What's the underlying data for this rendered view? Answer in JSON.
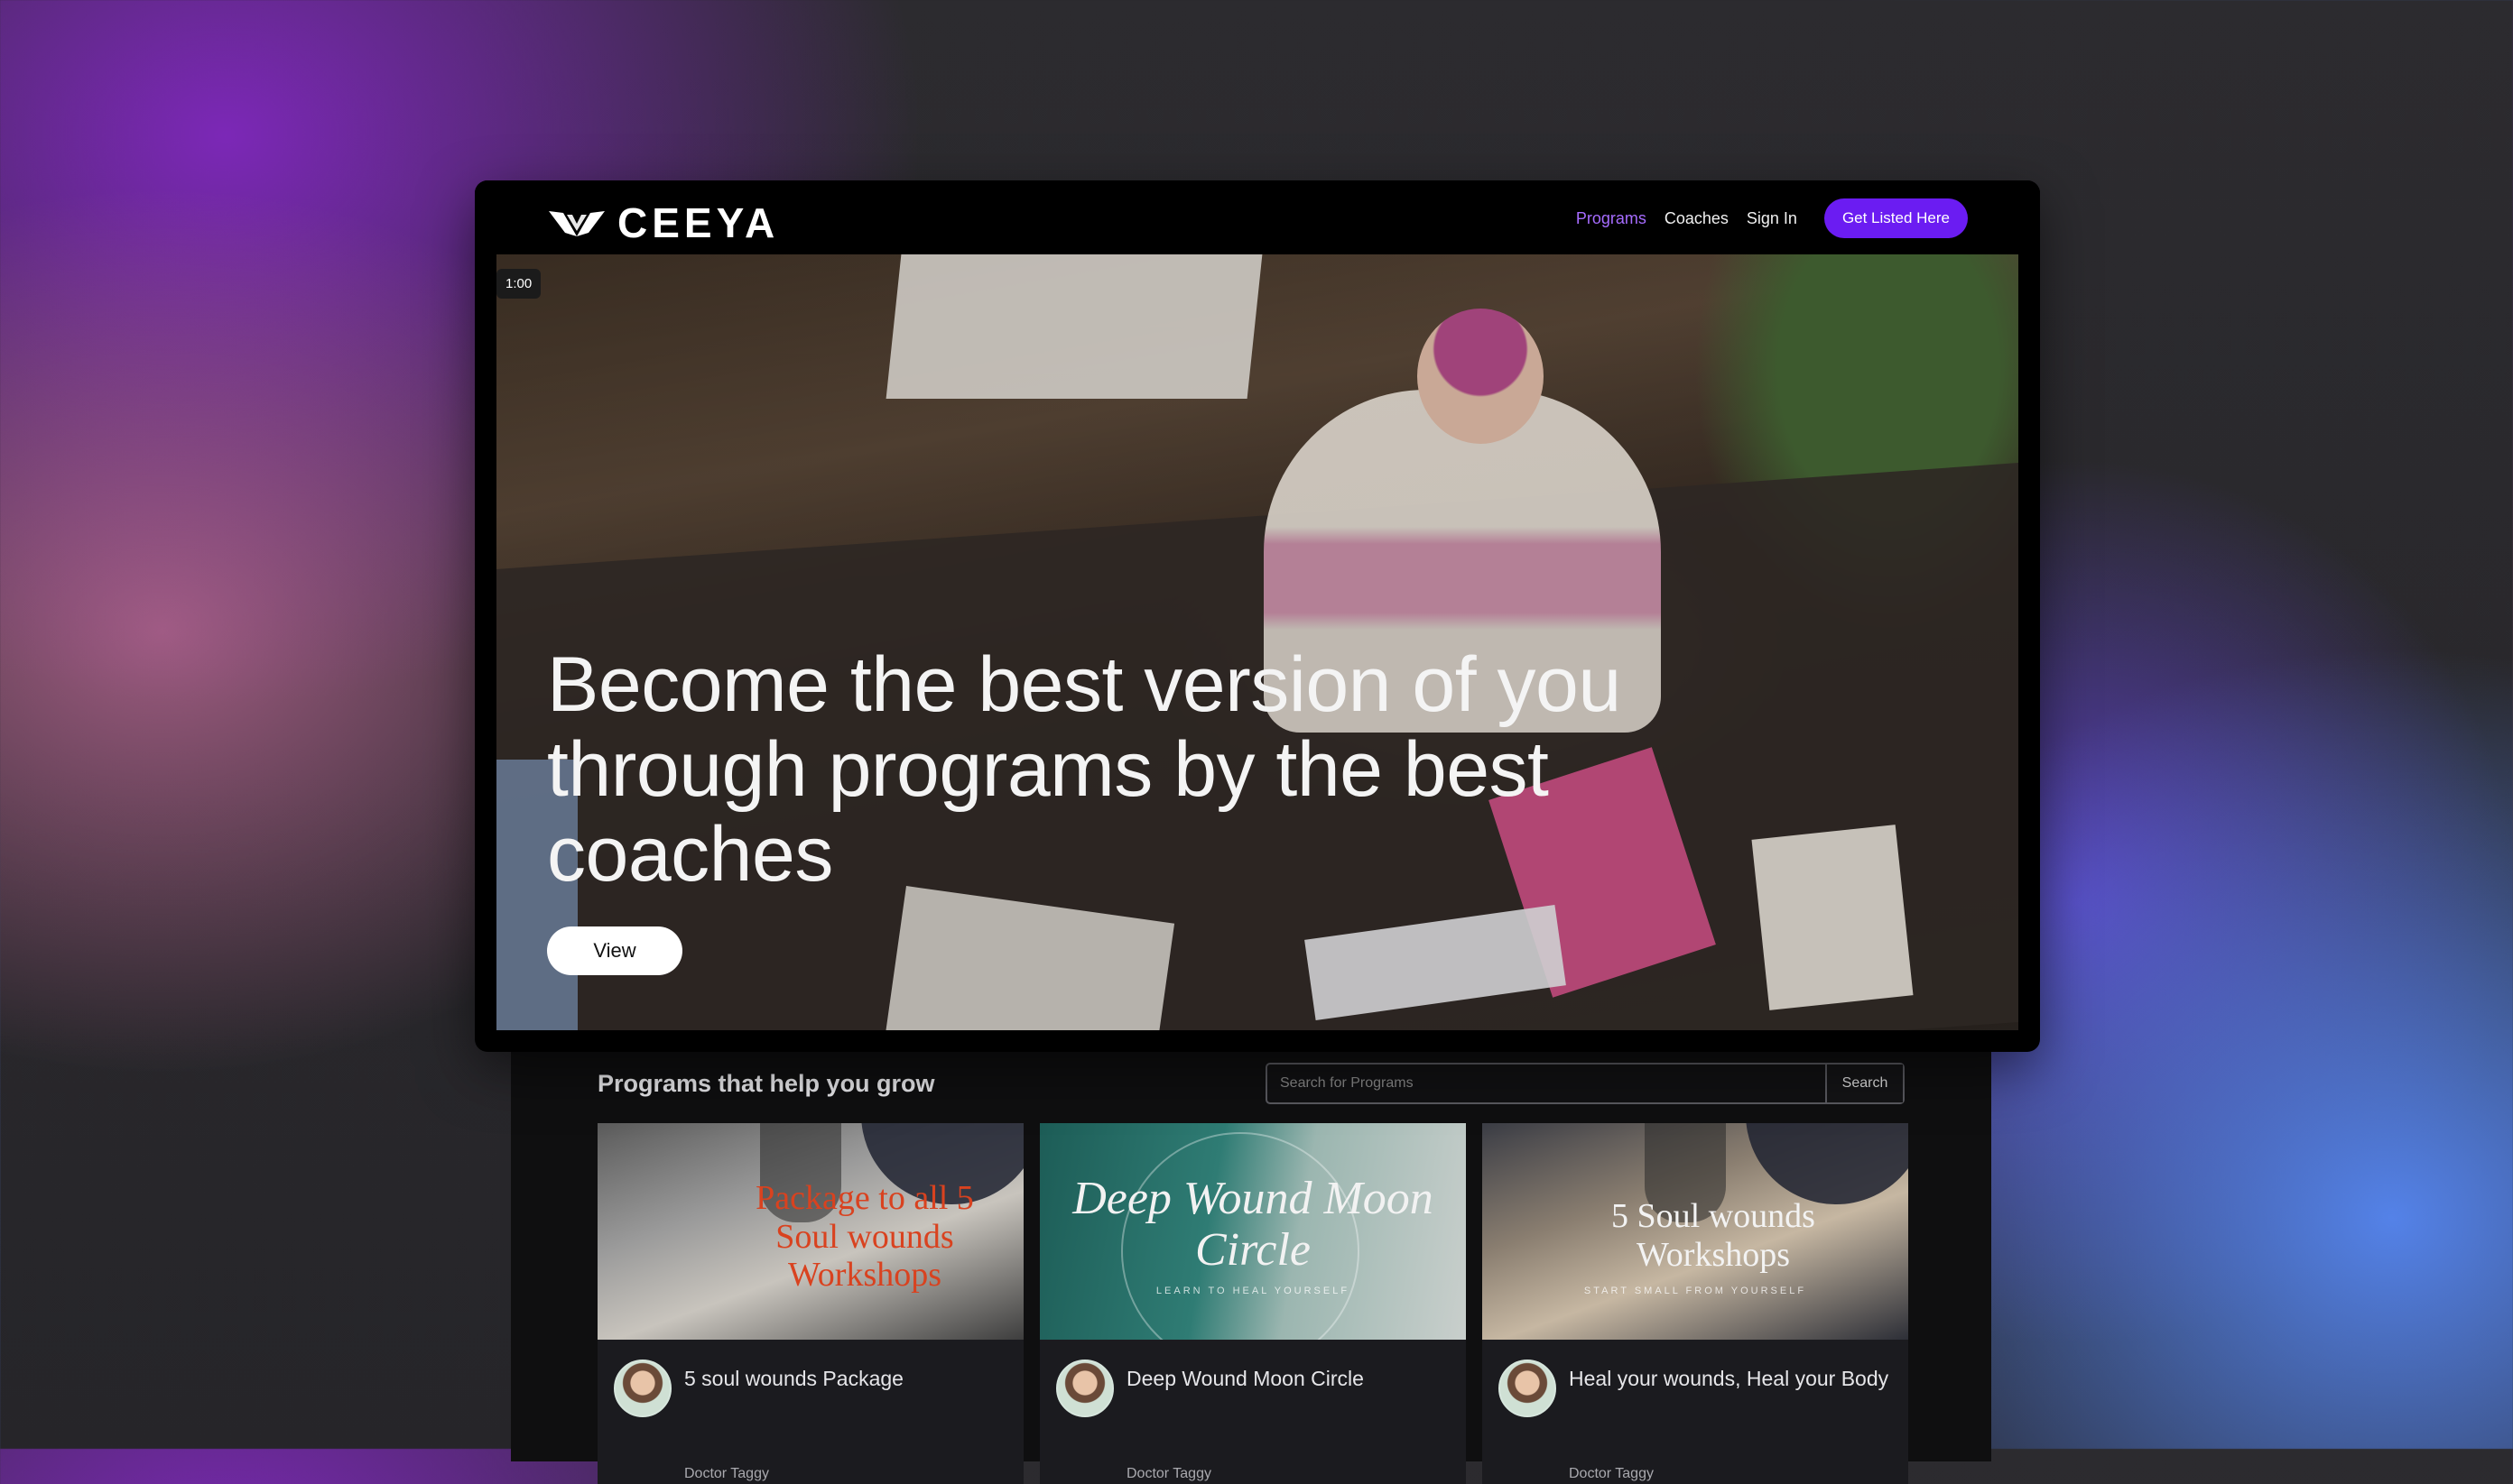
{
  "brand": {
    "name": "CEEYA"
  },
  "nav": {
    "links": [
      "Programs",
      "Coaches",
      "Sign In"
    ],
    "active": "Programs",
    "cta_label": "Get Listed Here",
    "cta_color": "#6b1cf2",
    "active_color": "#a66cff"
  },
  "hero": {
    "timer": "1:00",
    "heading": "Become the best version of you through programs by the best coaches",
    "button_label": "View"
  },
  "programs": {
    "title": "Programs that help you grow",
    "search_placeholder": "Search for Programs",
    "search_button": "Search",
    "cards": [
      {
        "thumb_text": "Package to all 5 Soul wounds Workshops",
        "thumb_sub": "",
        "title": "5 soul wounds Package",
        "author": "Doctor Taggy"
      },
      {
        "thumb_text": "Deep Wound Moon Circle",
        "thumb_sub": "LEARN TO HEAL YOURSELF",
        "title": "Deep Wound Moon Circle",
        "author": "Doctor Taggy"
      },
      {
        "thumb_text": "5 Soul wounds Workshops",
        "thumb_sub": "START SMALL FROM YOURSELF",
        "title": "Heal your wounds, Heal your Body",
        "author": "Doctor Taggy"
      }
    ]
  }
}
